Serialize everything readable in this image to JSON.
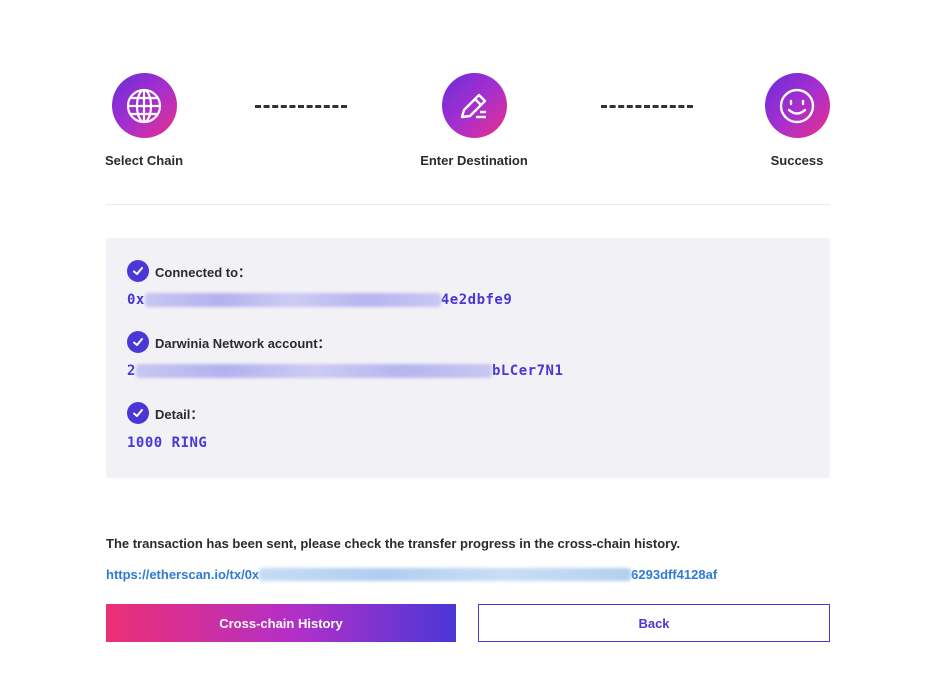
{
  "steps": [
    {
      "label": "Select Chain",
      "icon": "globe-icon"
    },
    {
      "label": "Enter Destination",
      "icon": "edit-icon"
    },
    {
      "label": "Success",
      "icon": "smile-icon"
    }
  ],
  "details": {
    "connected": {
      "title": "Connected to：",
      "prefix": "0x",
      "suffix": "4e2dbfe9"
    },
    "account": {
      "title": "Darwinia Network account：",
      "prefix": "2",
      "suffix": "bLCer7N1"
    },
    "detail": {
      "title": "Detail：",
      "value": "1000 RING"
    }
  },
  "message": "The transaction has been sent, please check the transfer progress in the cross-chain history.",
  "tx_link": {
    "prefix": "https://etherscan.io/tx/0x",
    "suffix": "6293dff4128af"
  },
  "buttons": {
    "history": "Cross-chain History",
    "back": "Back"
  },
  "colors": {
    "accent": "#4a37d6",
    "link": "#2f7bd6",
    "gradient_start": "#ec2f75"
  }
}
